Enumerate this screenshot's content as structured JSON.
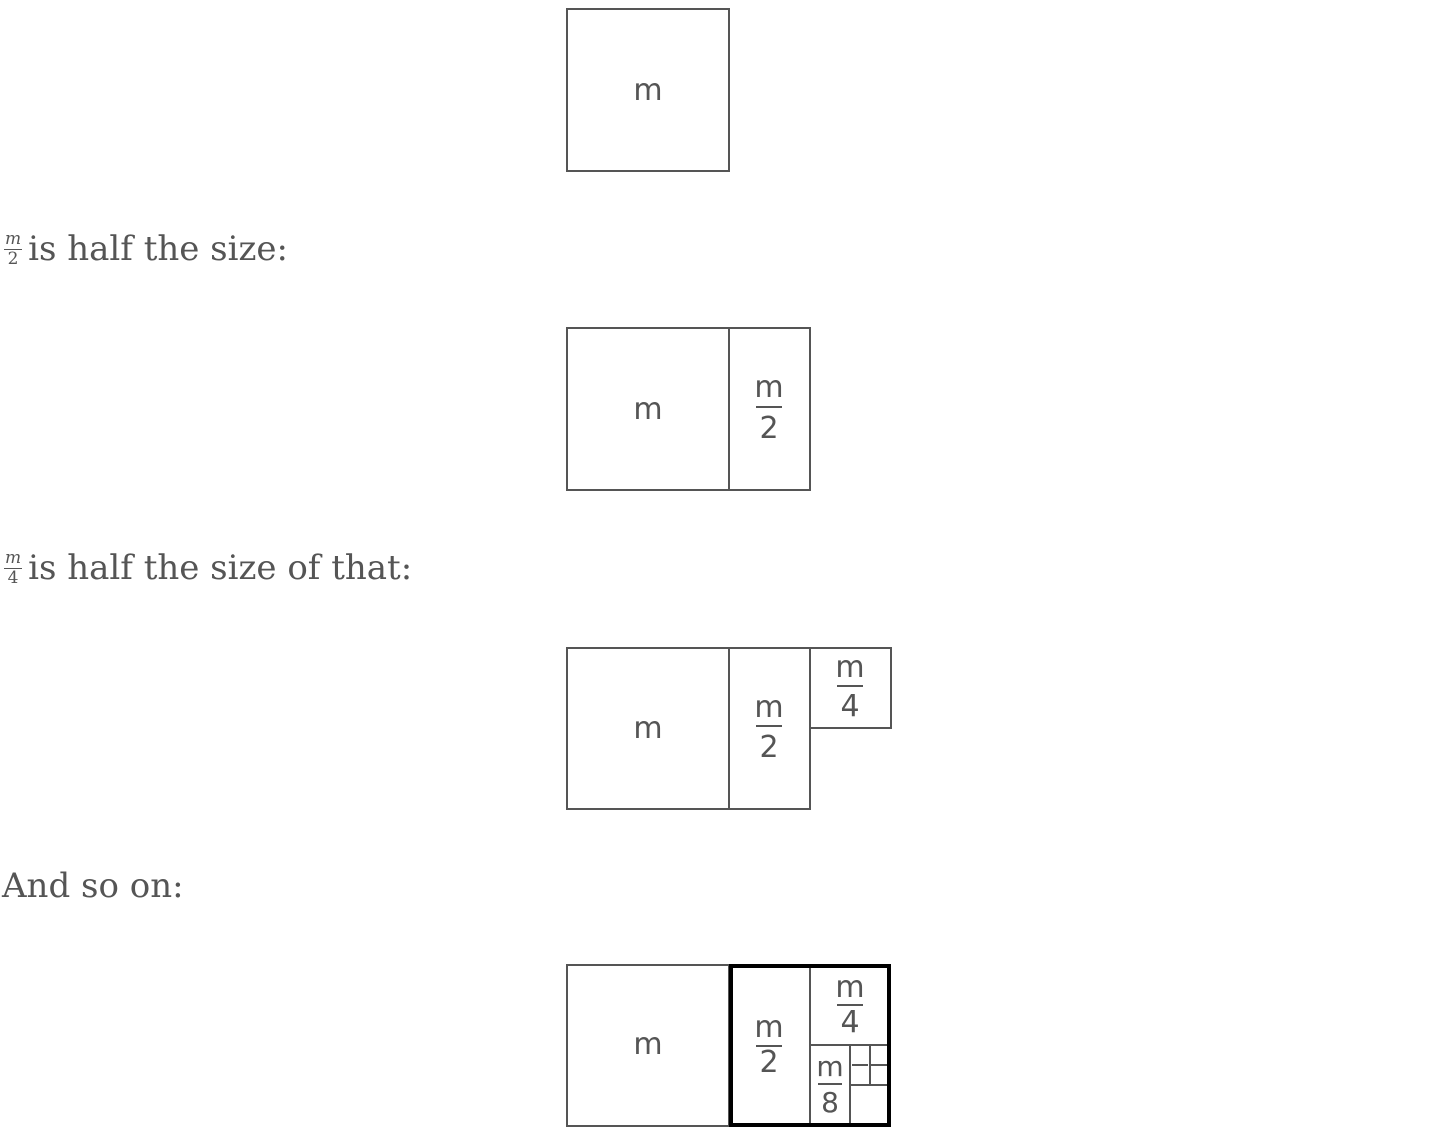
{
  "figures": {
    "whole": "m",
    "half_num": "m",
    "half_den": "2",
    "quarter_num": "m",
    "quarter_den": "4",
    "eighth_num": "m",
    "eighth_den": "8"
  },
  "captions": {
    "half_size": {
      "frac_num": "m",
      "frac_den": "2",
      "text": "is half the size:"
    },
    "half_of_that": {
      "frac_num": "m",
      "frac_den": "4",
      "text": "is half the size of that:"
    },
    "so_on": {
      "text": "And so on:"
    }
  },
  "colors": {
    "stroke": "#555555",
    "highlight": "#000000",
    "text": "#555555"
  }
}
